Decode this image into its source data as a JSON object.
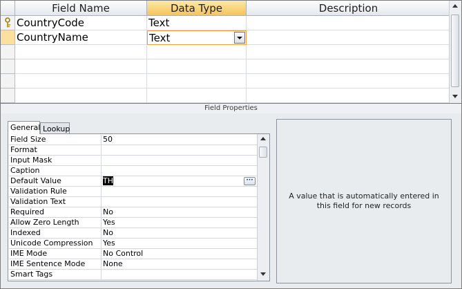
{
  "grid": {
    "headers": {
      "field_name": "Field Name",
      "data_type": "Data Type",
      "description": "Description"
    },
    "rows": [
      {
        "field_name": "CountryCode",
        "data_type": "Text",
        "description": "",
        "primary_key": true
      },
      {
        "field_name": "CountryName",
        "data_type": "Text",
        "description": "",
        "active": true
      }
    ]
  },
  "splitter": {
    "label": "Field Properties"
  },
  "tabs": {
    "general": "General",
    "lookup": "Lookup"
  },
  "properties": [
    {
      "name": "Field Size",
      "value": "50"
    },
    {
      "name": "Format",
      "value": ""
    },
    {
      "name": "Input Mask",
      "value": ""
    },
    {
      "name": "Caption",
      "value": ""
    },
    {
      "name": "Default Value",
      "value": "TH"
    },
    {
      "name": "Validation Rule",
      "value": ""
    },
    {
      "name": "Validation Text",
      "value": ""
    },
    {
      "name": "Required",
      "value": "No"
    },
    {
      "name": "Allow Zero Length",
      "value": "Yes"
    },
    {
      "name": "Indexed",
      "value": "No"
    },
    {
      "name": "Unicode Compression",
      "value": "Yes"
    },
    {
      "name": "IME Mode",
      "value": "No Control"
    },
    {
      "name": "IME Sentence Mode",
      "value": "None"
    },
    {
      "name": "Smart Tags",
      "value": ""
    }
  ],
  "help": {
    "text": "A value that is automatically entered in this field for new records"
  },
  "icons": {
    "key": "primary-key-icon",
    "dropdown": "chevron-down-icon",
    "build": "builder-ellipsis-icon"
  },
  "colors": {
    "selected_header": "#f6c35a",
    "active_row_selector": "#fde0a0",
    "focus_border": "#e8a040"
  }
}
